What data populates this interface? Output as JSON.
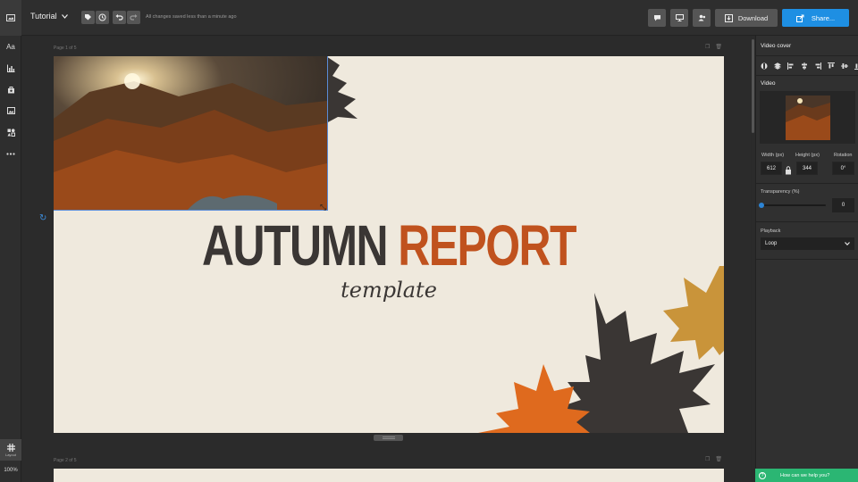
{
  "topbar": {
    "doc_title": "Tutorial",
    "saved_status": "All changes saved less than a minute ago",
    "download_label": "Download",
    "share_label": "Share..."
  },
  "left_toolbar": {
    "text_tool_label": "Aa",
    "layout_label": "Layout",
    "zoom": "100%"
  },
  "canvas": {
    "page1_label": "Page 1 of 5",
    "page2_label": "Page 2 of 5"
  },
  "slide": {
    "title_word1": "AUTUMN",
    "title_word2": "REPORT",
    "subtitle": "template"
  },
  "panel": {
    "title": "Video cover",
    "section_video": "Video",
    "width_label": "Width (px)",
    "height_label": "Height (px)",
    "rotation_label": "Rotation",
    "width_value": "612",
    "height_value": "344",
    "rotation_value": "0°",
    "transparency_label": "Transparency (%)",
    "transparency_value": "0",
    "playback_label": "Playback",
    "playback_value": "Loop",
    "help_text": "How can we help you?"
  },
  "colors": {
    "accent_blue": "#1e8fe3",
    "title_dark": "#3a3634",
    "title_orange": "#c0521e",
    "slide_bg": "#efe9dd",
    "help_green": "#2bb673"
  }
}
